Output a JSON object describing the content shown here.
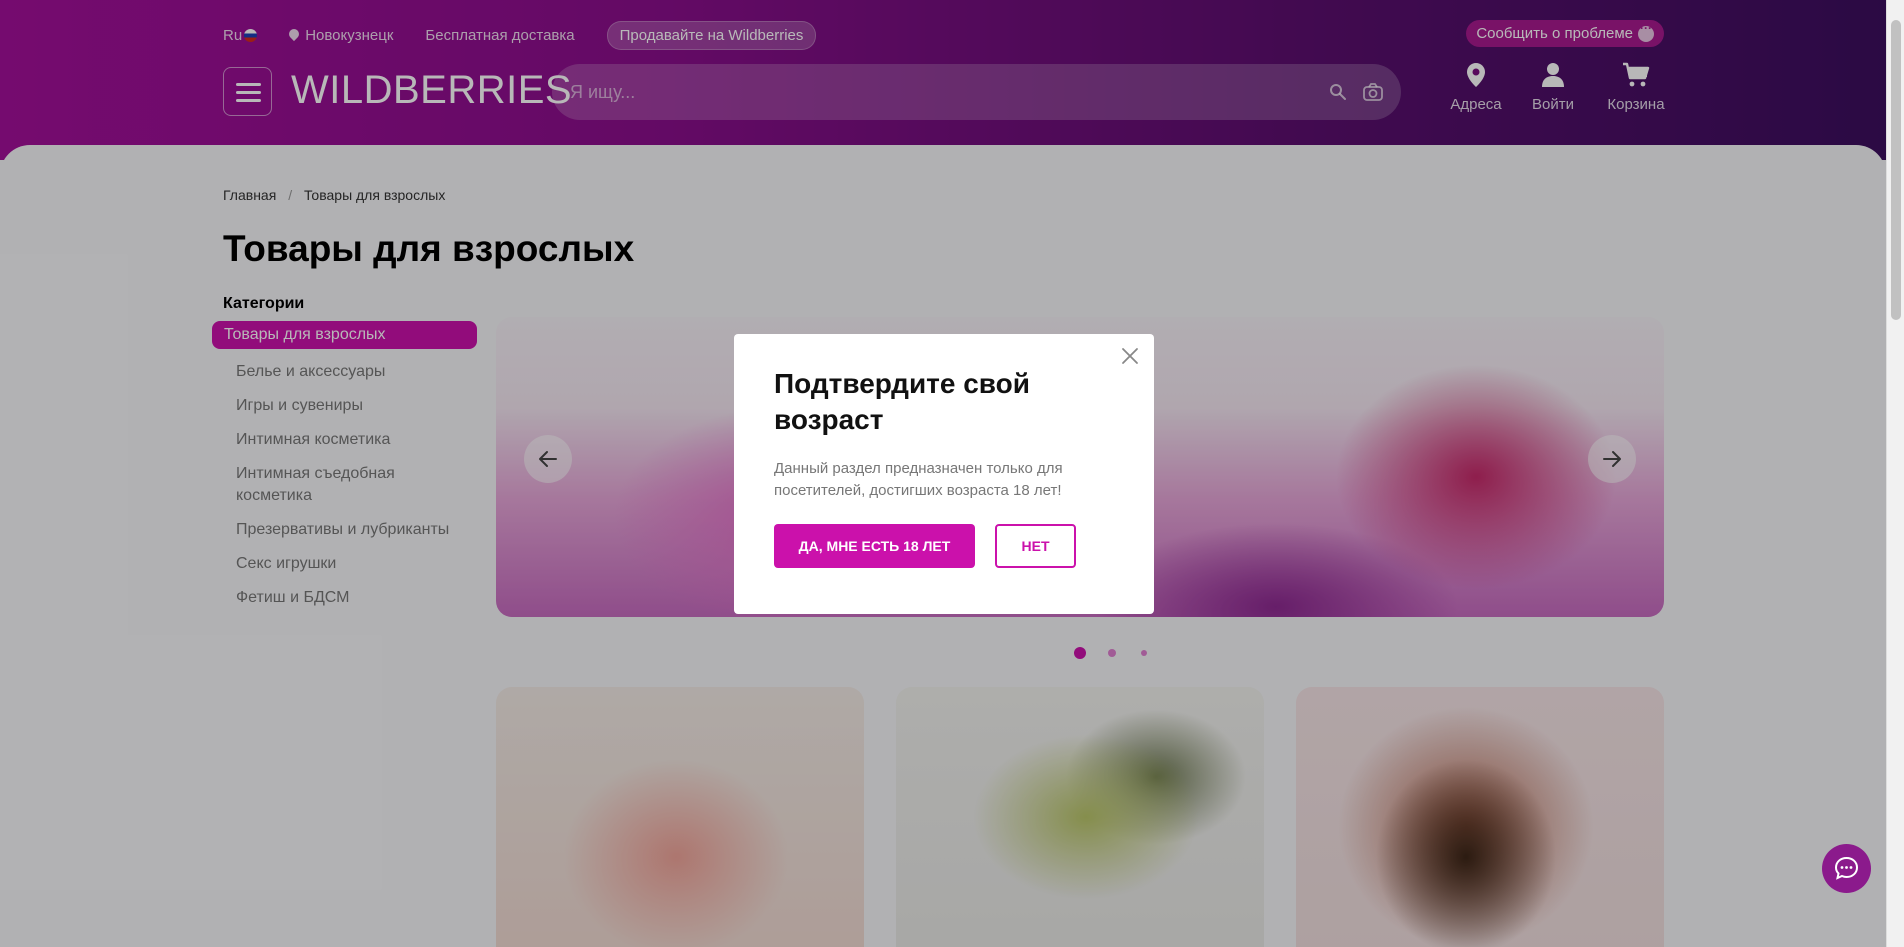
{
  "header": {
    "lang": "Ru",
    "city": "Новокузнецк",
    "free_delivery": "Бесплатная доставка",
    "sell_label": "Продавайте на Wildberries",
    "report_label": "Сообщить о проблеме",
    "logo": "WILDBERRIES",
    "search_placeholder": "Я ищу...",
    "nav": {
      "addresses": "Адреса",
      "login": "Войти",
      "cart": "Корзина"
    }
  },
  "breadcrumb": {
    "home": "Главная",
    "separator": "/",
    "current": "Товары для взрослых"
  },
  "page_title": "Товары для взрослых",
  "categories": {
    "title": "Категории",
    "items": [
      "Товары для взрослых",
      "Белье и аксессуары",
      "Игры и сувениры",
      "Интимная косметика",
      "Интимная съедобная косметика",
      "Презервативы и лубриканты",
      "Секс игрушки",
      "Фетиш и БДСМ"
    ]
  },
  "carousel": {
    "active_slide": 1,
    "slide_count": 3
  },
  "modal": {
    "title": "Подтвердите свой возраст",
    "text": "Данный раздел предназначен только для посетителей, достигших возраста 18 лет!",
    "yes_label": "ДА, МНЕ ЕСТЬ 18 ЛЕТ",
    "no_label": "НЕТ"
  },
  "colors": {
    "accent": "#cb11ab",
    "header_start": "#a3109a",
    "header_end": "#3b0e5e"
  }
}
